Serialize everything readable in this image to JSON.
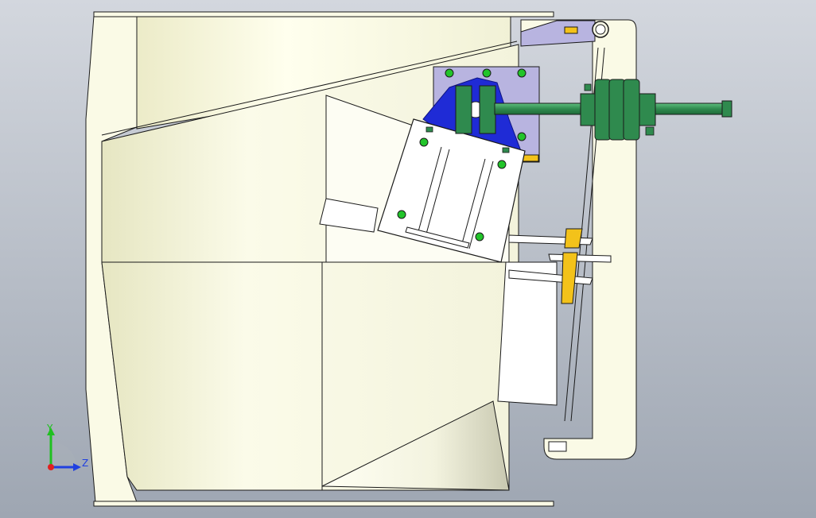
{
  "viewport": {
    "background_top": "#d3d7de",
    "background_bottom": "#9ea6b2"
  },
  "model": {
    "part_colors": {
      "housing": "#fafae6",
      "housing_shade": "#e9e9c8",
      "outline": "#1a1a1a",
      "motor_plate": "#b8b4e0",
      "actuator_body": "#1f2bd6",
      "shaft_green": "#2f8a4e",
      "shaft_dark": "#1f6b3a",
      "bolt_green": "#22c42a",
      "linkage_yellow": "#f3c21a",
      "plate_white": "#ffffff"
    }
  },
  "triad": {
    "y_label": "Y",
    "z_label": "Z",
    "y_color": "#20c020",
    "z_color": "#2040e0",
    "x_color": "#e02020"
  }
}
